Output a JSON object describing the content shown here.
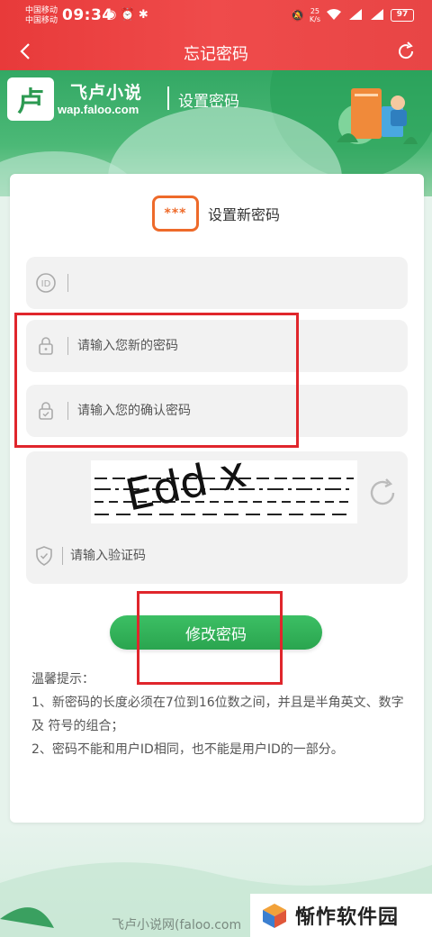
{
  "status_bar": {
    "carrier1": "中国移动",
    "carrier2": "中国移动",
    "time": "09:34",
    "net_speed": "25",
    "net_unit": "K/s",
    "battery": "97"
  },
  "nav": {
    "title": "忘记密码"
  },
  "header": {
    "logo_char": "卢",
    "site_name": "飞卢小说",
    "site_url": "wap.faloo.com",
    "subtitle": "设置密码"
  },
  "card": {
    "icon_text": "***",
    "title": "设置新密码",
    "id_field": {
      "value": "",
      "placeholder": ""
    },
    "new_password_field": {
      "placeholder": "请输入您新的密码"
    },
    "confirm_password_field": {
      "placeholder": "请输入您的确认密码"
    },
    "captcha": {
      "text": "Edd x",
      "placeholder": "请输入验证码"
    },
    "submit_label": "修改密码",
    "tips_title": "温馨提示：",
    "tip1": "1、新密码的长度必须在7位到16位数之间，并且是半角英文、数字及 符号的组合；",
    "tip2": "2、密码不能和用户ID相同，也不能是用户ID的一部分。"
  },
  "footer": {
    "text": "飞卢小说网(faloo.com",
    "watermark": "惭怍软件园"
  },
  "colors": {
    "accent_red": "#e83a3a",
    "brand_green": "#2aa54f",
    "orange_icon": "#ee6a2a",
    "annotation_red": "#e0262c"
  }
}
